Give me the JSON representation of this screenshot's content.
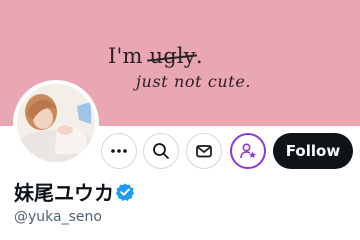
{
  "banner": {
    "line1_before": "I'm ",
    "line1_struck": "ugly",
    "line1_after": ".",
    "line2": "just not cute."
  },
  "profile": {
    "display_name": "妹尾ユウカ",
    "handle": "@yuka_seno",
    "verified": true
  },
  "actions": {
    "follow_label": "Follow",
    "more_icon": "more-dots-icon",
    "search_icon": "search-icon",
    "message_icon": "envelope-icon",
    "subscribe_icon": "person-star-icon"
  },
  "colors": {
    "banner_bg": "#e8a7b2",
    "follow_bg": "#0f1419",
    "verified_badge": "#1d9bf0",
    "subscribe_accent": "#8f38d8"
  }
}
